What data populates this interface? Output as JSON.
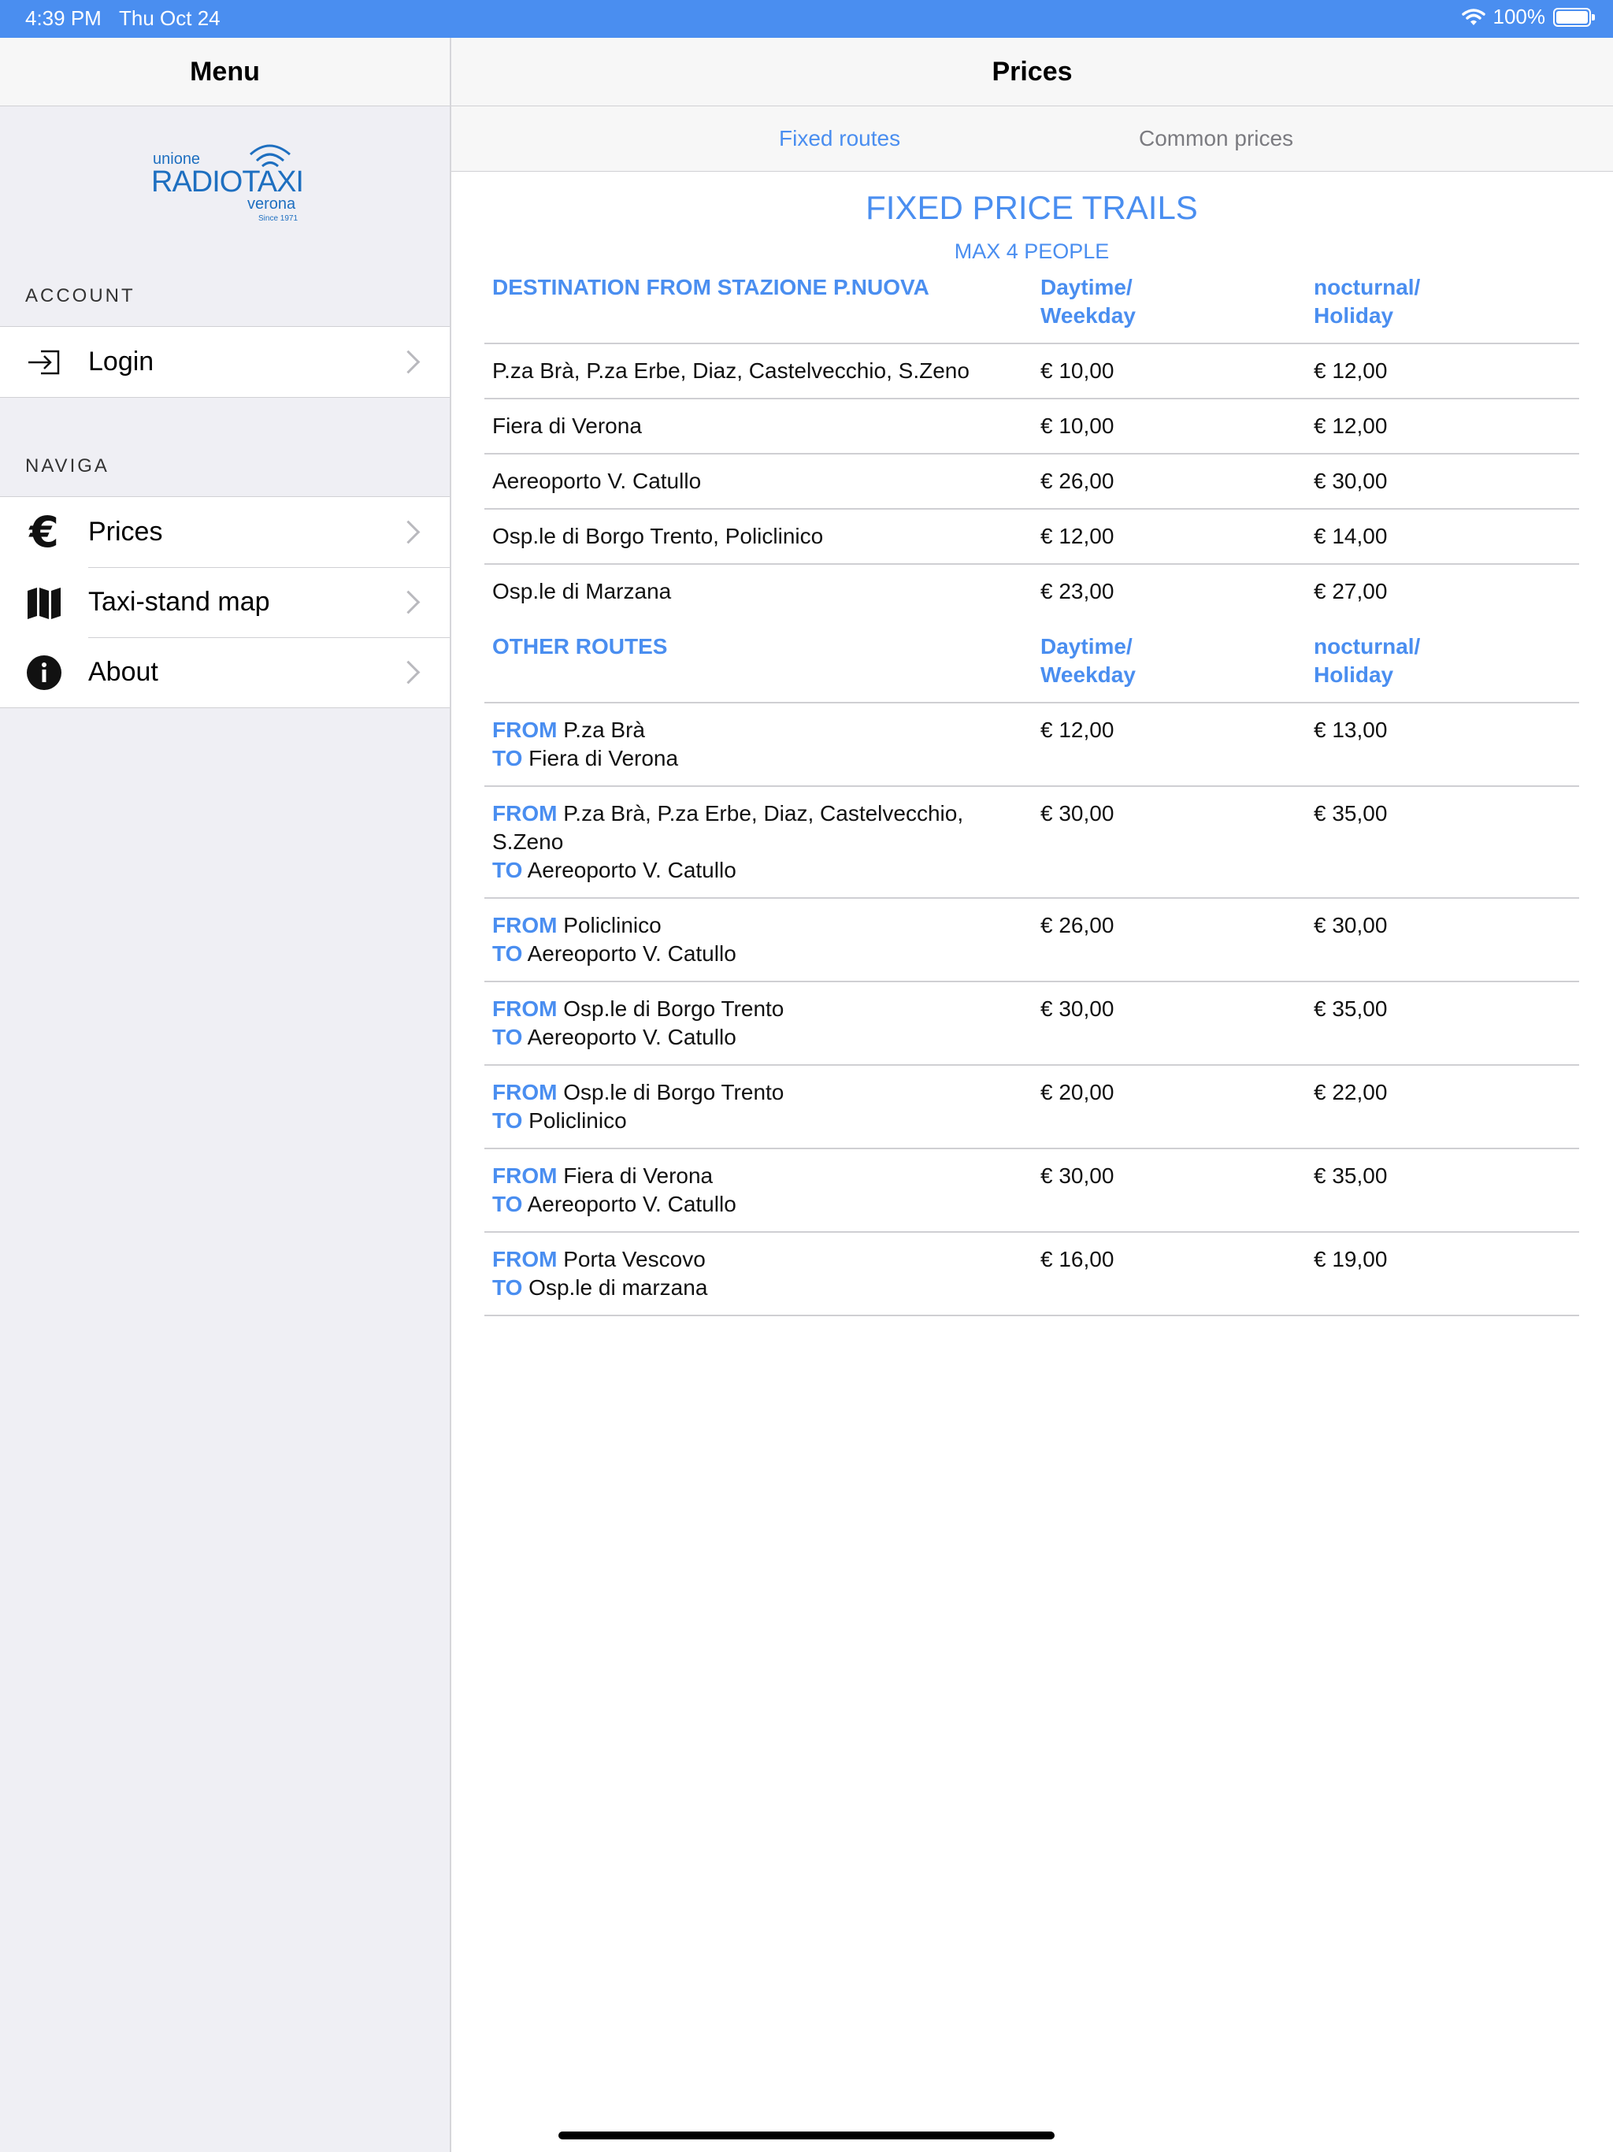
{
  "status_bar": {
    "time": "4:39 PM",
    "date": "Thu Oct 24",
    "battery": "100%"
  },
  "sidebar": {
    "title": "Menu",
    "logo": {
      "line1": "unione",
      "line2": "RADIOTAXI",
      "line3": "verona",
      "line4": "Since 1971"
    },
    "account_label": "ACCOUNT",
    "account_items": [
      {
        "label": "Login",
        "icon": "login-icon"
      }
    ],
    "nav_label": "NAVIGA",
    "nav_items": [
      {
        "label": "Prices",
        "icon": "euro-icon"
      },
      {
        "label": "Taxi-stand map",
        "icon": "map-icon"
      },
      {
        "label": "About",
        "icon": "info-icon"
      }
    ]
  },
  "main": {
    "title": "Prices",
    "tabs": [
      {
        "label": "Fixed routes",
        "active": true
      },
      {
        "label": "Common prices",
        "active": false
      }
    ],
    "heading": "FIXED PRICE TRAILS",
    "subheading": "MAX 4 PEOPLE",
    "table1": {
      "headers": [
        "DESTINATION FROM STAZIONE P.NUOVA",
        "Daytime/\nWeekday",
        "nocturnal/\nHoliday"
      ],
      "rows": [
        {
          "dest": "P.za Brà, P.za Erbe, Diaz, Castelvecchio, S.Zeno",
          "day": "€ 10,00",
          "night": "€ 12,00"
        },
        {
          "dest": "Fiera di Verona",
          "day": "€ 10,00",
          "night": "€ 12,00"
        },
        {
          "dest": "Aereoporto V. Catullo",
          "day": "€ 26,00",
          "night": "€ 30,00"
        },
        {
          "dest": "Osp.le di Borgo Trento, Policlinico",
          "day": "€ 12,00",
          "night": "€ 14,00"
        },
        {
          "dest": "Osp.le di Marzana",
          "day": "€ 23,00",
          "night": "€ 27,00"
        }
      ]
    },
    "table2": {
      "headers": [
        "OTHER ROUTES",
        "Daytime/\nWeekday",
        "nocturnal/\nHoliday"
      ],
      "from_kw": "FROM",
      "to_kw": "TO",
      "rows": [
        {
          "from": "P.za Brà",
          "to": "Fiera di Verona",
          "day": "€ 12,00",
          "night": "€ 13,00"
        },
        {
          "from": "P.za Brà, P.za Erbe, Diaz, Castelvecchio, S.Zeno",
          "to": "Aereoporto V. Catullo",
          "day": "€ 30,00",
          "night": "€ 35,00"
        },
        {
          "from": "Policlinico",
          "to": "Aereoporto V. Catullo",
          "day": "€ 26,00",
          "night": "€ 30,00"
        },
        {
          "from": "Osp.le di Borgo Trento",
          "to": "Aereoporto V. Catullo",
          "day": "€ 30,00",
          "night": "€ 35,00"
        },
        {
          "from": "Osp.le di Borgo Trento",
          "to": "Policlinico",
          "day": "€ 20,00",
          "night": "€ 22,00"
        },
        {
          "from": "Fiera di Verona",
          "to": "Aereoporto V. Catullo",
          "day": "€ 30,00",
          "night": "€ 35,00"
        },
        {
          "from": "Porta Vescovo",
          "to": "Osp.le di marzana",
          "day": "€ 16,00",
          "night": "€ 19,00"
        }
      ]
    }
  },
  "colors": {
    "accent": "#4a8ef0",
    "status_bar": "#4a8ef0",
    "sidebar_bg": "#efeff4",
    "inactive_tab": "#7b7b80"
  }
}
